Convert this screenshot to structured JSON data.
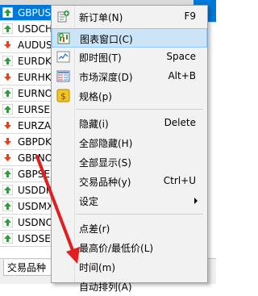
{
  "market_watch": {
    "symbols": [
      {
        "name": "GBPUS",
        "dir": "up"
      },
      {
        "name": "USDCH",
        "dir": "up"
      },
      {
        "name": "AUDUS",
        "dir": "down"
      },
      {
        "name": "EURDK",
        "dir": "up"
      },
      {
        "name": "EURHK",
        "dir": "down"
      },
      {
        "name": "EURNO",
        "dir": "up"
      },
      {
        "name": "EURSE",
        "dir": "up"
      },
      {
        "name": "EURZA",
        "dir": "down"
      },
      {
        "name": "GBPDK",
        "dir": "down"
      },
      {
        "name": "GBPNO",
        "dir": "down"
      },
      {
        "name": "GBPSE",
        "dir": "up"
      },
      {
        "name": "USDDK",
        "dir": "up"
      },
      {
        "name": "USDMX",
        "dir": "up"
      },
      {
        "name": "USDNO",
        "dir": "up"
      },
      {
        "name": "USDSE",
        "dir": "up"
      }
    ],
    "tab_label": "交易品种"
  },
  "menu": {
    "items": [
      {
        "label": "新订单(N)",
        "shortcut": "F9",
        "icon": "new-order-icon"
      },
      {
        "label": "图表窗口(C)",
        "shortcut": "",
        "icon": "chart-window-icon"
      },
      {
        "label": "即时图(T)",
        "shortcut": "Space",
        "icon": "tick-chart-icon"
      },
      {
        "label": "市场深度(D)",
        "shortcut": "Alt+B",
        "icon": "market-depth-icon"
      },
      {
        "label": "规格(p)",
        "shortcut": "",
        "icon": "specification-icon"
      },
      {
        "label": "隐藏(i)",
        "shortcut": "Delete"
      },
      {
        "label": "全部隐藏(H)",
        "shortcut": ""
      },
      {
        "label": "全部显示(S)",
        "shortcut": ""
      },
      {
        "label": "交易品种(y)",
        "shortcut": "Ctrl+U"
      },
      {
        "label": "设定",
        "shortcut": ""
      },
      {
        "label": "点差(r)",
        "shortcut": ""
      },
      {
        "label": "最高价/最低价(L)",
        "shortcut": ""
      },
      {
        "label": "时间(m)",
        "shortcut": ""
      },
      {
        "label": "自动排列(A)",
        "shortcut": ""
      }
    ]
  },
  "colors": {
    "up_arrow": "#2e9e3c",
    "down_arrow": "#e0421e",
    "selection": "#0078d7",
    "menu_highlight": "#cce4f7",
    "annotation_arrow": "#e02020"
  }
}
